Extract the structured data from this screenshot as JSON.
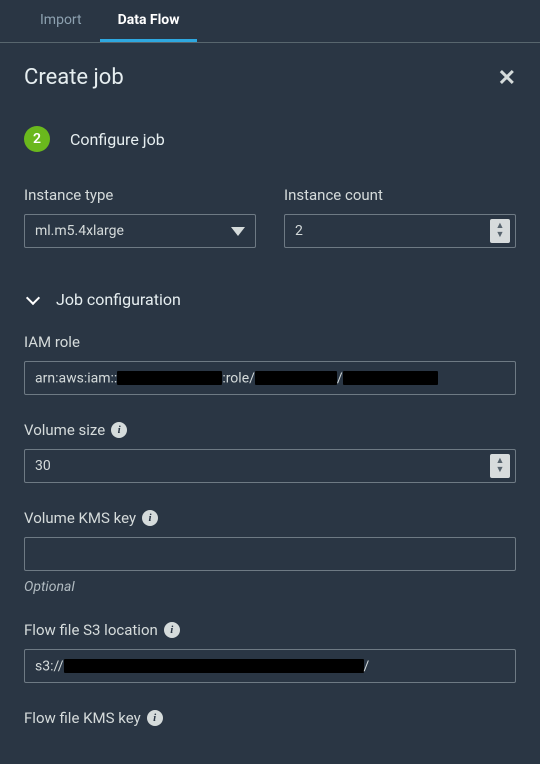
{
  "tabs": {
    "import": "Import",
    "dataflow": "Data Flow"
  },
  "panel": {
    "title": "Create job"
  },
  "step": {
    "number": "2",
    "label": "Configure job"
  },
  "instance_type": {
    "label": "Instance type",
    "value": "ml.m5.4xlarge"
  },
  "instance_count": {
    "label": "Instance count",
    "value": "2"
  },
  "job_config": {
    "label": "Job configuration"
  },
  "iam_role": {
    "label": "IAM role",
    "prefix": "arn:aws:iam::",
    "mid": ":role/",
    "slash": "/"
  },
  "volume_size": {
    "label": "Volume size",
    "value": "30"
  },
  "volume_kms": {
    "label": "Volume KMS key",
    "optional": "Optional"
  },
  "flow_s3": {
    "label": "Flow file S3 location",
    "prefix": "s3://",
    "slash": "/"
  },
  "flow_kms": {
    "label": "Flow file KMS key"
  }
}
